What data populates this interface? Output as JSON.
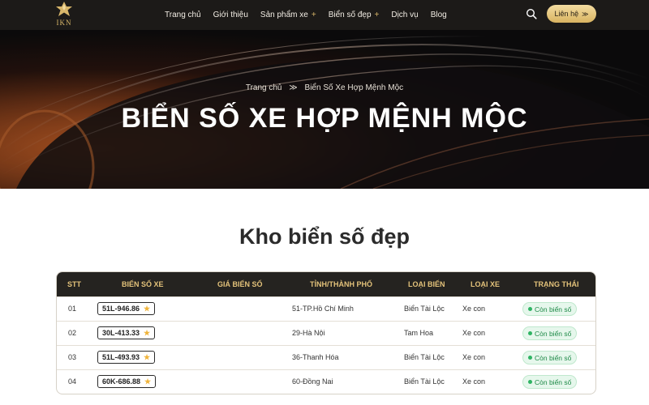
{
  "header": {
    "logo_text": "IKN",
    "nav": [
      {
        "label": "Trang chủ",
        "has_plus": false
      },
      {
        "label": "Giới thiệu",
        "has_plus": false
      },
      {
        "label": "Sản phẩm xe",
        "has_plus": true
      },
      {
        "label": "Biển số đẹp",
        "has_plus": true
      },
      {
        "label": "Dịch vụ",
        "has_plus": false
      },
      {
        "label": "Blog",
        "has_plus": false
      }
    ],
    "search_icon": "search-icon",
    "contact_label": "Liên hệ",
    "contact_arrow": "≫"
  },
  "hero": {
    "breadcrumb_home": "Trang chủ",
    "breadcrumb_sep": "≫",
    "breadcrumb_current": "Biển Số Xe Hợp Mệnh Mộc",
    "title": "BIỂN SỐ XE HỢP MỆNH MỘC"
  },
  "section": {
    "title": "Kho biển số đẹp"
  },
  "table": {
    "headers": [
      "STT",
      "Biển số xe",
      "Giá biển số",
      "Tỉnh/Thành phố",
      "Loại biển",
      "Loại xe",
      "Trạng thái"
    ],
    "rows": [
      {
        "stt": "01",
        "plate": "51L-946.86",
        "price": "",
        "city": "51-TP.Hồ Chí Minh",
        "plate_type": "Biển Tài Lộc",
        "vehicle": "Xe con",
        "status": "Còn biển số"
      },
      {
        "stt": "02",
        "plate": "30L-413.33",
        "price": "",
        "city": "29-Hà Nội",
        "plate_type": "Tam Hoa",
        "vehicle": "Xe con",
        "status": "Còn biển số"
      },
      {
        "stt": "03",
        "plate": "51L-493.93",
        "price": "",
        "city": "36-Thanh Hóa",
        "plate_type": "Biển Tài Lộc",
        "vehicle": "Xe con",
        "status": "Còn biển số"
      },
      {
        "stt": "04",
        "plate": "60K-686.88",
        "price": "",
        "city": "60-Đồng Nai",
        "plate_type": "Biển Tài Lộc",
        "vehicle": "Xe con",
        "status": "Còn biển số"
      }
    ]
  },
  "colors": {
    "accent_gold": "#d8b66a",
    "header_bg": "#1c1a18",
    "status_green": "#1f8a48"
  }
}
